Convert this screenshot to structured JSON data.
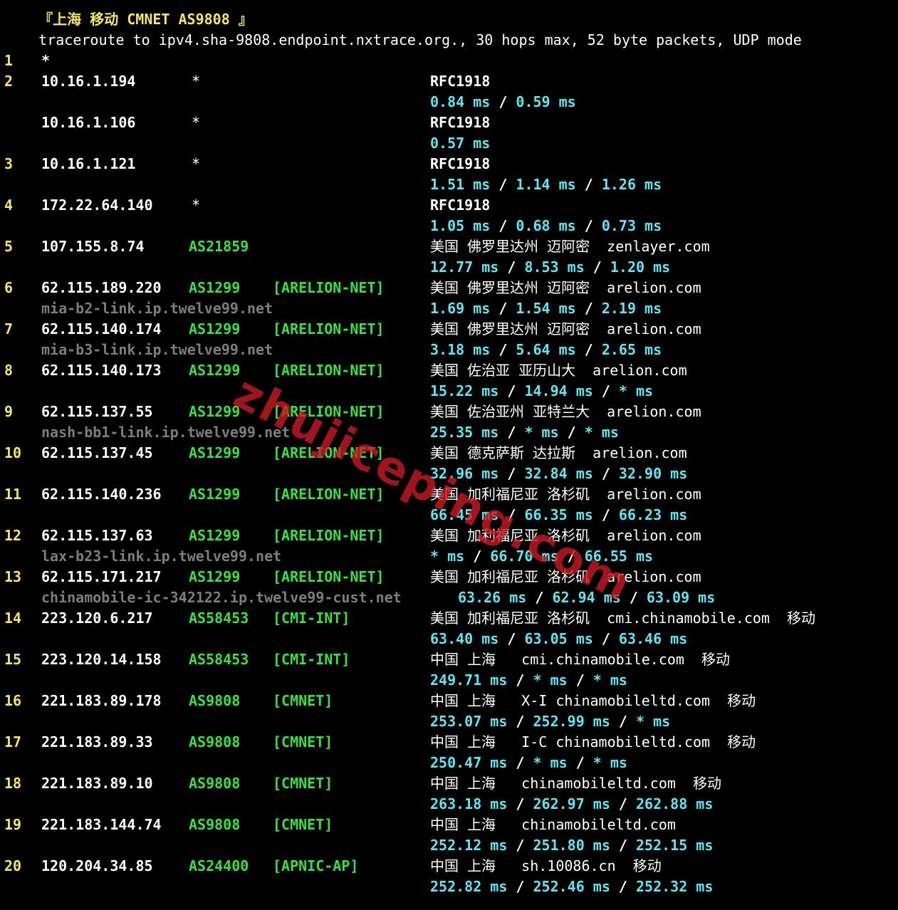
{
  "header": {
    "text": "『上海 移动 CMNET AS9808 』"
  },
  "title": "traceroute to ipv4.sha-9808.endpoint.nxtrace.org., 30 hops max, 52 byte packets, UDP mode",
  "first_hop": {
    "hop": "1",
    "value": "*"
  },
  "colors": {
    "background": "#000000",
    "hop_number": "#f5e663",
    "asn": "#36e33e",
    "latency": "#5ee7f2",
    "hostname": "#7d7d7d",
    "watermark": "#cd1923"
  },
  "hops": [
    {
      "hop": "2",
      "ip": "10.16.1.194",
      "star": "*",
      "geo": "RFC1918",
      "rtt": [
        "0.84 ms",
        "0.59 ms"
      ]
    },
    {
      "hop": "",
      "ip": "10.16.1.106",
      "star": "*",
      "geo": "RFC1918",
      "rtt": [
        "0.57 ms"
      ]
    },
    {
      "hop": "3",
      "ip": "10.16.1.121",
      "star": "*",
      "geo": "RFC1918",
      "rtt": [
        "1.51 ms",
        "1.14 ms",
        "1.26 ms"
      ]
    },
    {
      "hop": "4",
      "ip": "172.22.64.140",
      "star": "*",
      "geo": "RFC1918",
      "rtt": [
        "1.05 ms",
        "0.68 ms",
        "0.73 ms"
      ]
    },
    {
      "hop": "5",
      "ip": "107.155.8.74",
      "as": "AS21859",
      "geo": "美国 佛罗里达州 迈阿密  zenlayer.com",
      "rtt": [
        "12.77 ms",
        "8.53 ms",
        "1.20 ms"
      ]
    },
    {
      "hop": "6",
      "ip": "62.115.189.220",
      "as": "AS1299",
      "net": "[ARELION-NET]",
      "geo": "美国 佛罗里达州 迈阿密  arelion.com",
      "host": "mia-b2-link.ip.twelve99.net",
      "rtt": [
        "1.69 ms",
        "1.54 ms",
        "2.19 ms"
      ]
    },
    {
      "hop": "7",
      "ip": "62.115.140.174",
      "as": "AS1299",
      "net": "[ARELION-NET]",
      "geo": "美国 佛罗里达州 迈阿密  arelion.com",
      "host": "mia-b3-link.ip.twelve99.net",
      "rtt": [
        "3.18 ms",
        "5.64 ms",
        "2.65 ms"
      ]
    },
    {
      "hop": "8",
      "ip": "62.115.140.173",
      "as": "AS1299",
      "net": "[ARELION-NET]",
      "geo": "美国 佐治亚 亚历山大  arelion.com",
      "rtt": [
        "15.22 ms",
        "14.94 ms",
        "* ms"
      ]
    },
    {
      "hop": "9",
      "ip": "62.115.137.55",
      "as": "AS1299",
      "net": "[ARELION-NET]",
      "geo": "美国 佐治亚州 亚特兰大  arelion.com",
      "host": "nash-bb1-link.ip.twelve99.net",
      "rtt": [
        "25.35 ms",
        "* ms",
        "* ms"
      ]
    },
    {
      "hop": "10",
      "ip": "62.115.137.45",
      "as": "AS1299",
      "net": "[ARELION-NET]",
      "geo": "美国 德克萨斯 达拉斯  arelion.com",
      "rtt": [
        "32.96 ms",
        "32.84 ms",
        "32.90 ms"
      ]
    },
    {
      "hop": "11",
      "ip": "62.115.140.236",
      "as": "AS1299",
      "net": "[ARELION-NET]",
      "geo": "美国 加利福尼亚 洛杉矶  arelion.com",
      "rtt": [
        "66.45 ms",
        "66.35 ms",
        "66.23 ms"
      ]
    },
    {
      "hop": "12",
      "ip": "62.115.137.63",
      "as": "AS1299",
      "net": "[ARELION-NET]",
      "geo": "美国 加利福尼亚 洛杉矶  arelion.com",
      "host": "lax-b23-link.ip.twelve99.net",
      "rtt": [
        "* ms",
        "66.70 ms",
        "66.55 ms"
      ]
    },
    {
      "hop": "13",
      "ip": "62.115.171.217",
      "as": "AS1299",
      "net": "[ARELION-NET]",
      "geo": "美国 加利福尼亚 洛杉矶  arelion.com",
      "host": "chinamobile-ic-342122.ip.twelve99-cust.net",
      "rtt": [
        "63.26 ms",
        "62.94 ms",
        "63.09 ms"
      ],
      "rtt_inline": true
    },
    {
      "hop": "14",
      "ip": "223.120.6.217",
      "as": "AS58453",
      "net": "[CMI-INT]",
      "geo": "美国 加利福尼亚 洛杉矶  cmi.chinamobile.com  移动",
      "rtt": [
        "63.40 ms",
        "63.05 ms",
        "63.46 ms"
      ]
    },
    {
      "hop": "15",
      "ip": "223.120.14.158",
      "as": "AS58453",
      "net": "[CMI-INT]",
      "geo": "中国 上海   cmi.chinamobile.com  移动",
      "rtt": [
        "249.71 ms",
        "* ms",
        "* ms"
      ]
    },
    {
      "hop": "16",
      "ip": "221.183.89.178",
      "as": "AS9808",
      "net": "[CMNET]",
      "geo": "中国 上海   X-I chinamobileltd.com  移动",
      "rtt": [
        "253.07 ms",
        "252.99 ms",
        "* ms"
      ]
    },
    {
      "hop": "17",
      "ip": "221.183.89.33",
      "as": "AS9808",
      "net": "[CMNET]",
      "geo": "中国 上海   I-C chinamobileltd.com  移动",
      "rtt": [
        "250.47 ms",
        "* ms",
        "* ms"
      ]
    },
    {
      "hop": "18",
      "ip": "221.183.89.10",
      "as": "AS9808",
      "net": "[CMNET]",
      "geo": "中国 上海   chinamobileltd.com  移动",
      "rtt": [
        "263.18 ms",
        "262.97 ms",
        "262.88 ms"
      ]
    },
    {
      "hop": "19",
      "ip": "221.183.144.74",
      "as": "AS9808",
      "net": "[CMNET]",
      "geo": "中国 上海   chinamobileltd.com",
      "rtt": [
        "252.12 ms",
        "251.80 ms",
        "252.15 ms"
      ]
    },
    {
      "hop": "20",
      "ip": "120.204.34.85",
      "as": "AS24400",
      "net": "[APNIC-AP]",
      "geo": "中国 上海   sh.10086.cn  移动",
      "rtt": [
        "252.82 ms",
        "252.46 ms",
        "252.32 ms"
      ]
    }
  ],
  "watermark": "zhujiceping.com"
}
